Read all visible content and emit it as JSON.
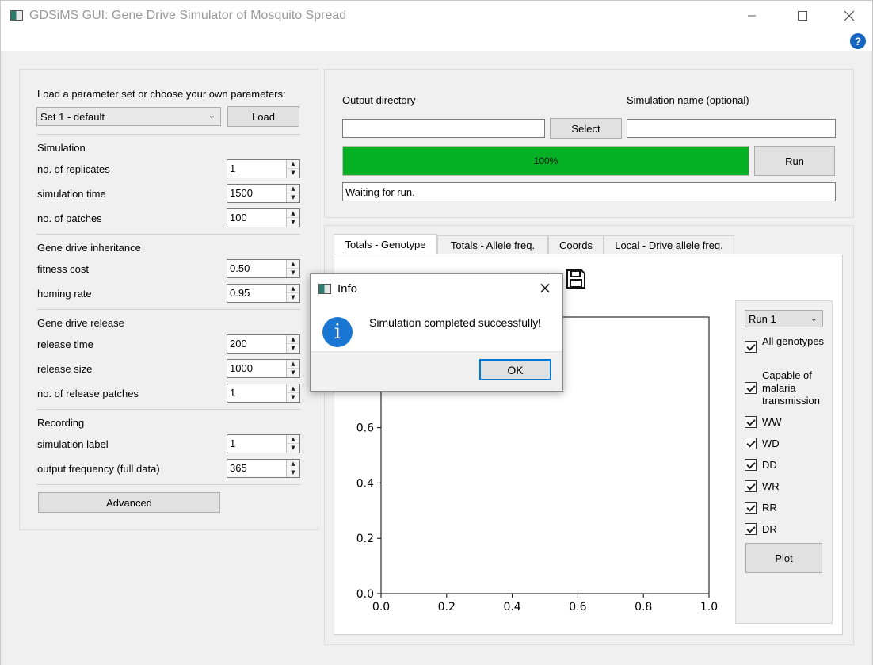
{
  "window": {
    "title": "GDSiMS GUI: Gene Drive Simulator of Mosquito Spread",
    "minimize_icon": "minimize-icon",
    "maximize_icon": "maximize-icon",
    "close_icon": "close-icon",
    "help_icon": "help-icon",
    "help_symbol": "?"
  },
  "params": {
    "load_prompt": "Load a parameter set or choose your own parameters:",
    "set_selected": "Set 1 - default",
    "load_button": "Load",
    "simulation_heading": "Simulation",
    "replicates_label": "no. of replicates",
    "replicates_value": "1",
    "sim_time_label": "simulation time",
    "sim_time_value": "1500",
    "patches_label": "no. of patches",
    "patches_value": "100",
    "inheritance_heading": "Gene drive inheritance",
    "fitness_label": "fitness cost",
    "fitness_value": "0.50",
    "homing_label": "homing rate",
    "homing_value": "0.95",
    "release_heading": "Gene drive release",
    "release_time_label": "release time",
    "release_time_value": "200",
    "release_size_label": "release size",
    "release_size_value": "1000",
    "release_patches_label": "no. of release patches",
    "release_patches_value": "1",
    "recording_heading": "Recording",
    "sim_label_label": "simulation label",
    "sim_label_value": "1",
    "output_freq_label": "output frequency (full data)",
    "output_freq_value": "365",
    "advanced_button": "Advanced"
  },
  "run": {
    "output_dir_label": "Output directory",
    "output_dir_value": "",
    "select_button": "Select",
    "sim_name_label": "Simulation name (optional)",
    "sim_name_value": "",
    "progress_text": "100%",
    "progress_fraction": 1.0,
    "run_button": "Run",
    "status_text": "Waiting for run."
  },
  "tabs": [
    "Totals - Genotype",
    "Totals - Allele freq.",
    "Coords",
    "Local - Drive allele freq."
  ],
  "plot": {
    "toolbar_icons": [
      "home-icon",
      "back-icon",
      "forward-icon",
      "pan-icon",
      "zoom-icon",
      "configure-icon",
      "edit-icon",
      "save-icon"
    ],
    "y_ticks": [
      "0.0",
      "0.2",
      "0.4",
      "0.6"
    ],
    "x_ticks": [
      "0.0",
      "0.2",
      "0.4",
      "0.6",
      "0.8",
      "1.0"
    ],
    "run_selected": "Run 1",
    "checkboxes": [
      {
        "label": "All genotypes",
        "checked": true
      },
      {
        "label": "Capable of malaria transmission",
        "checked": true
      },
      {
        "label": "WW",
        "checked": true
      },
      {
        "label": "WD",
        "checked": true
      },
      {
        "label": "DD",
        "checked": true
      },
      {
        "label": "WR",
        "checked": true
      },
      {
        "label": "RR",
        "checked": true
      },
      {
        "label": "DR",
        "checked": true
      }
    ],
    "plot_button": "Plot"
  },
  "dialog": {
    "title": "Info",
    "message": "Simulation completed successfully!",
    "ok_button": "OK",
    "info_icon": "info-icon",
    "info_symbol": "i",
    "close_symbol": "×"
  },
  "colors": {
    "progress_green": "#06b025",
    "accent_blue": "#0078d7"
  }
}
